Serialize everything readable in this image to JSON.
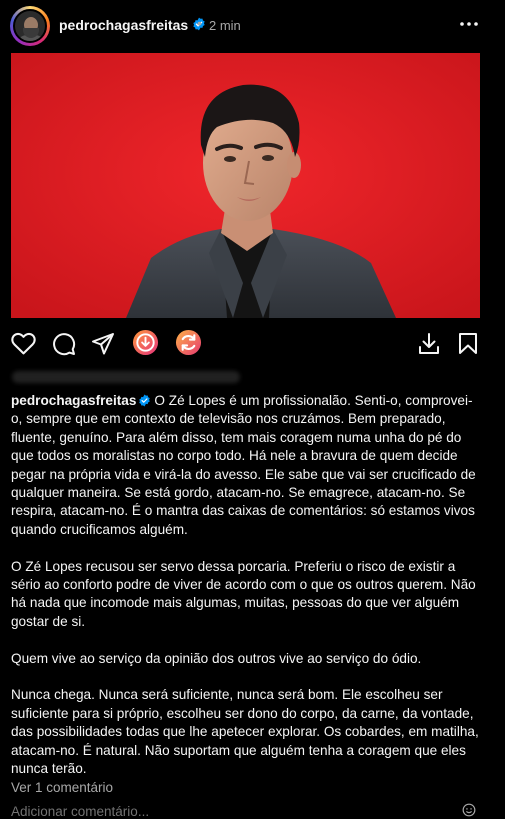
{
  "post": {
    "username": "pedrochagasfreitas",
    "separator": "•",
    "time": "2 min"
  },
  "caption": {
    "username": "pedrochagasfreitas",
    "paragraphs": [
      "O Zé Lopes é um profissionalão. Senti-o, comprovei-o, sempre que em contexto de televisão nos cruzámos. Bem preparado, fluente, genuíno. Para além disso, tem mais coragem numa unha do pé do que todos os moralistas no corpo todo. Há nele a bravura de quem decide pegar na própria vida e virá-la do avesso. Ele sabe que vai ser crucificado de qualquer maneira. Se está gordo, atacam-no. Se emagrece, atacam-no. Se respira, atacam-no. É o mantra das caixas de comentários: só estamos vivos quando crucificamos alguém.",
      "O Zé Lopes recusou ser servo dessa porcaria. Preferiu o risco de existir a sério ao conforto podre de viver de acordo com o que os outros querem. Não há nada que incomode mais algumas, muitas, pessoas do que ver alguém gostar de si.",
      "Quem vive ao serviço da opinião dos outros vive ao serviço do ódio.",
      "Nunca chega. Nunca será suficiente, nunca será bom. Ele escolheu ser suficiente para si próprio, escolheu ser dono do corpo, da carne, da vontade, das possibilidades todas que lhe apetecer explorar. Os cobardes, em matilha, atacam-no. É natural. Não suportam que alguém tenha a coragem que eles nunca terão."
    ]
  },
  "comments": {
    "view_label": "Ver 1 comentário",
    "add_placeholder": "Adicionar comentário..."
  },
  "icons": {
    "like": "heart-icon",
    "comment": "comment-icon",
    "share": "share-icon",
    "save": "bookmark-icon",
    "download": "download-icon"
  },
  "colors": {
    "background": "#000000",
    "text": "#f5f5f5",
    "muted": "#a8a8a8",
    "verified": "#0095f6",
    "photo_bg": "#e01f26"
  }
}
